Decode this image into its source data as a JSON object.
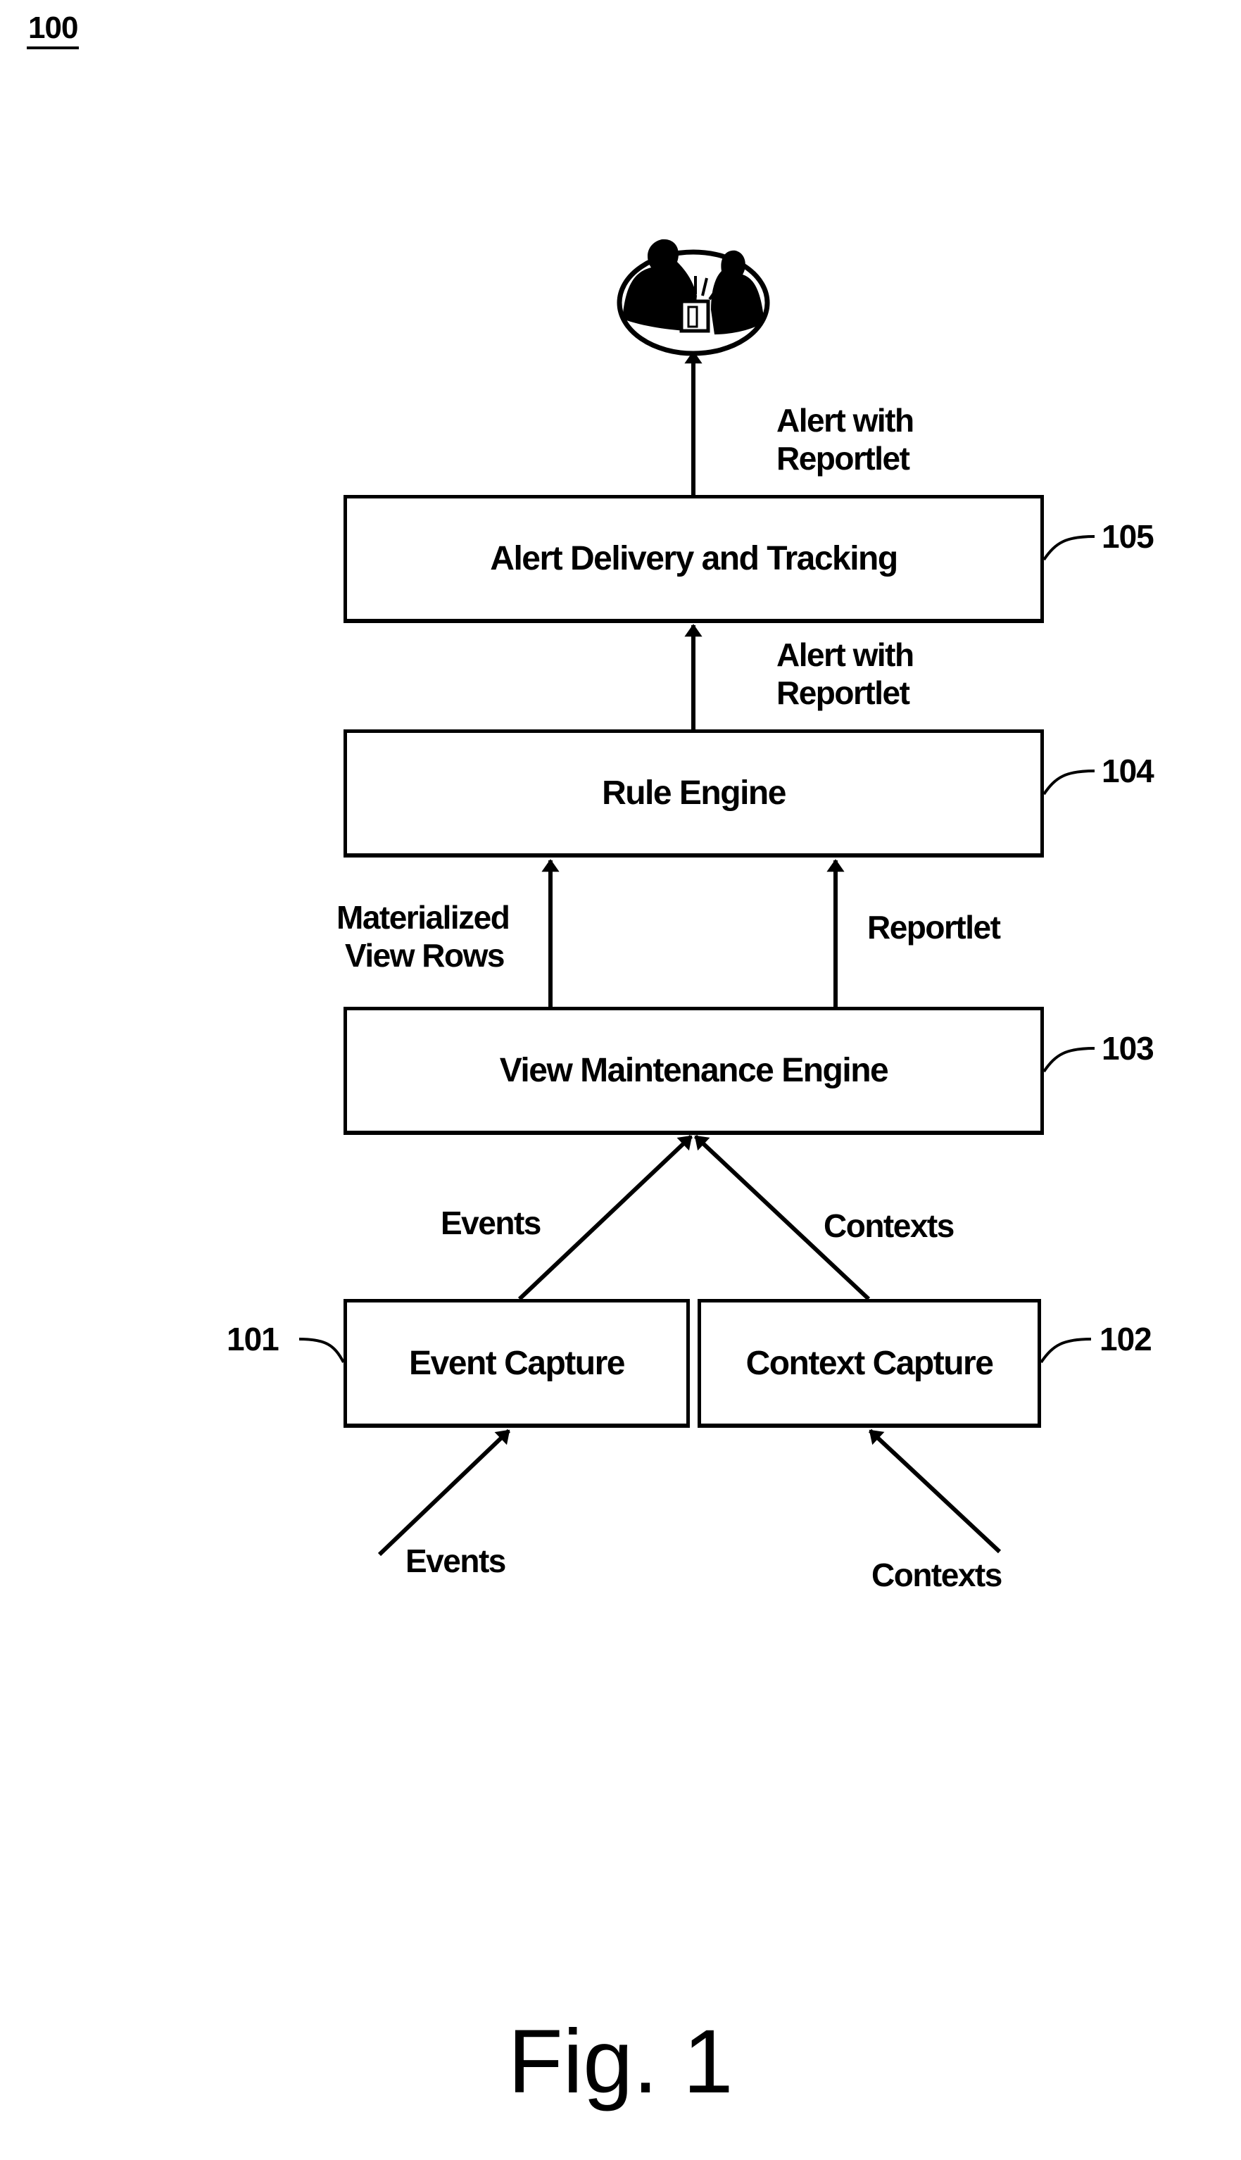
{
  "figure": {
    "reference_number": "100",
    "caption": "Fig. 1"
  },
  "boxes": {
    "alert_delivery": {
      "label": "Alert Delivery and Tracking",
      "ref": "105"
    },
    "rule_engine": {
      "label": "Rule Engine",
      "ref": "104"
    },
    "view_maintenance": {
      "label": "View Maintenance Engine",
      "ref": "103"
    },
    "event_capture": {
      "label": "Event Capture",
      "ref": "101"
    },
    "context_capture": {
      "label": "Context Capture",
      "ref": "102"
    }
  },
  "flows": {
    "alert_to_user_line1": "Alert with",
    "alert_to_user_line2": "Reportlet",
    "rule_to_alert_line1": "Alert with",
    "rule_to_alert_line2": "Reportlet",
    "mat_view_line1": "Materialized",
    "mat_view_line2": "View Rows",
    "reportlet": "Reportlet",
    "events_upper": "Events",
    "contexts_upper": "Contexts",
    "events_input": "Events",
    "contexts_input": "Contexts"
  },
  "icons": {
    "users": "people-with-alert-icon"
  }
}
